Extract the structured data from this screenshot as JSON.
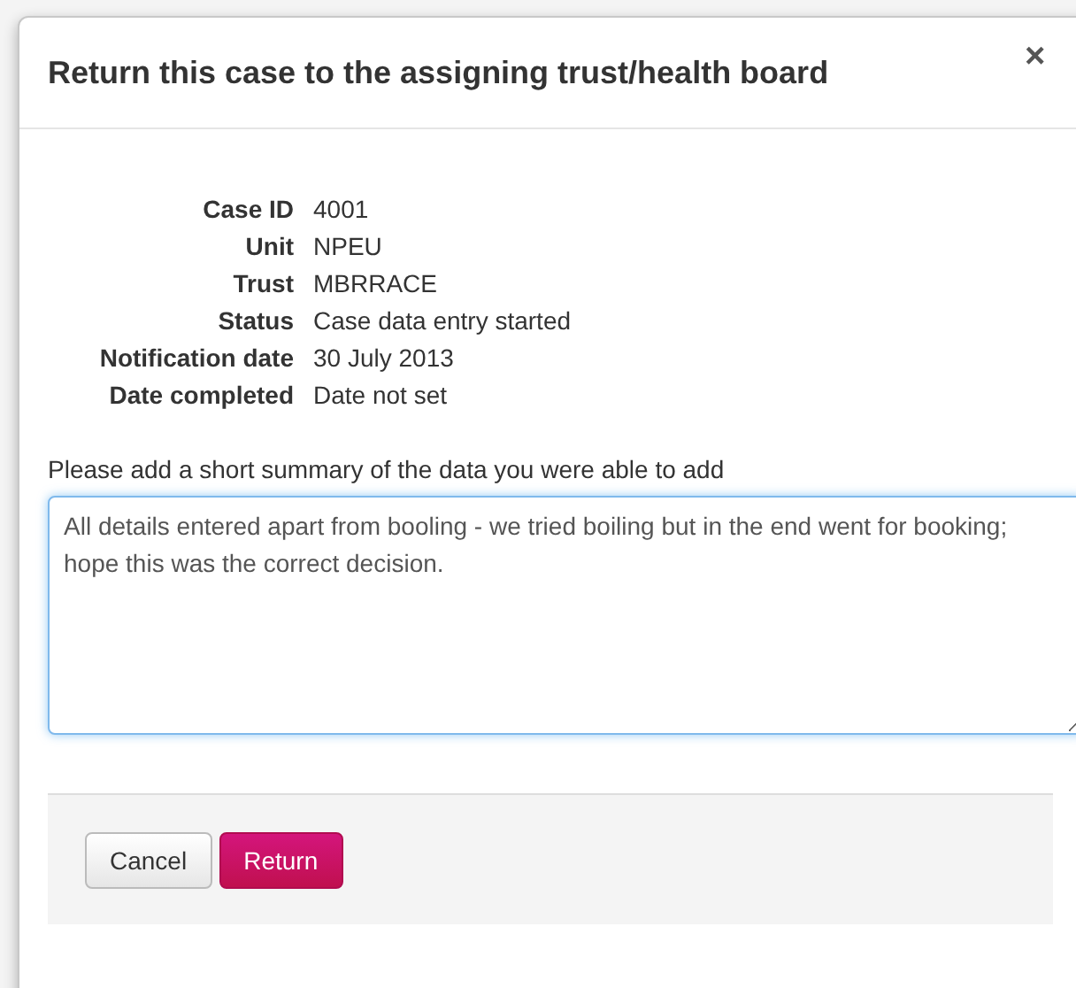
{
  "dialog": {
    "title": "Return this case to the assigning trust/health board",
    "close": "×",
    "details": [
      {
        "label": "Case ID",
        "value": "4001"
      },
      {
        "label": "Unit",
        "value": "NPEU"
      },
      {
        "label": "Trust",
        "value": "MBRRACE"
      },
      {
        "label": "Status",
        "value": "Case data entry started"
      },
      {
        "label": "Notification date",
        "value": "30 July 2013"
      },
      {
        "label": "Date completed",
        "value": "Date not set"
      }
    ],
    "summary": {
      "label": "Please add a short summary of the data you were able to add",
      "value": "All details entered apart from booling - we tried boiling but in the end went for booking; hope this was the correct decision."
    },
    "buttons": [
      {
        "label": "Cancel",
        "kind": "default"
      },
      {
        "label": "Return",
        "kind": "primary"
      }
    ]
  }
}
